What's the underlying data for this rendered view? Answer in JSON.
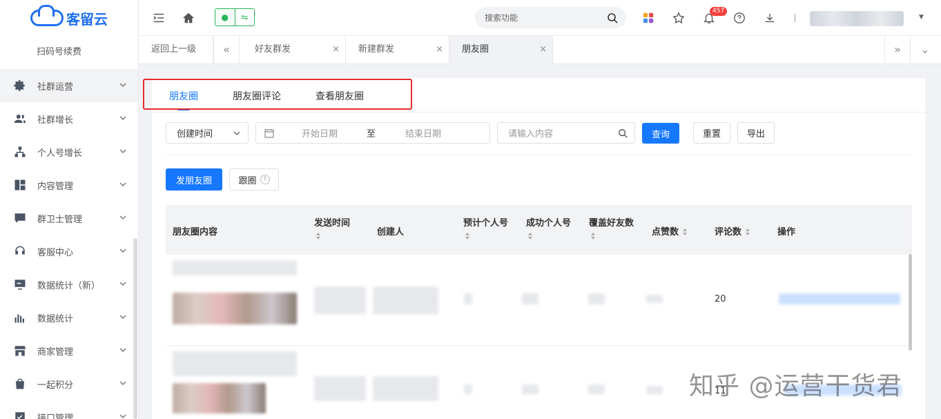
{
  "sidebar": {
    "brand": "客留云",
    "sub_item": "扫码号续费",
    "items": [
      {
        "label": "社群运营",
        "icon": "gear-icon"
      },
      {
        "label": "社群增长",
        "icon": "users-icon"
      },
      {
        "label": "个人号增长",
        "icon": "org-chart-icon"
      },
      {
        "label": "内容管理",
        "icon": "layout-icon"
      },
      {
        "label": "群卫士管理",
        "icon": "message-board-icon"
      },
      {
        "label": "客服中心",
        "icon": "headset-icon"
      },
      {
        "label": "数据统计（新）",
        "icon": "monitor-icon"
      },
      {
        "label": "数据统计",
        "icon": "bar-chart-icon"
      },
      {
        "label": "商家管理",
        "icon": "store-icon"
      },
      {
        "label": "一起积分",
        "icon": "bag-icon"
      },
      {
        "label": "接口管理",
        "icon": "checklist-icon"
      }
    ]
  },
  "header": {
    "search_placeholder": "搜索功能",
    "notification_count": "457"
  },
  "tabs": {
    "back": "返回上一级",
    "items": [
      {
        "label": "好友群发"
      },
      {
        "label": "新建群发"
      },
      {
        "label": "朋友圈"
      }
    ]
  },
  "subtabs": [
    "朋友圈",
    "朋友圈评论",
    "查看朋友圈"
  ],
  "filters": {
    "time_type": "创建时间",
    "start_placeholder": "开始日期",
    "range_sep": "至",
    "end_placeholder": "结束日期",
    "content_placeholder": "请输入内容",
    "query": "查询",
    "reset": "重置",
    "export": "导出"
  },
  "actions": {
    "post": "发朋友圈",
    "follow": "跟圈",
    "help": "?"
  },
  "table": {
    "columns": [
      "朋友圈内容",
      "发送时间",
      "创建人",
      "预计个人号",
      "成功个人号",
      "覆盖好友数",
      "点赞数",
      "评论数",
      "操作"
    ],
    "rows": [
      {
        "comments": "20"
      },
      {
        "comments": "11"
      }
    ]
  },
  "watermark": "知乎 @运营干货君"
}
